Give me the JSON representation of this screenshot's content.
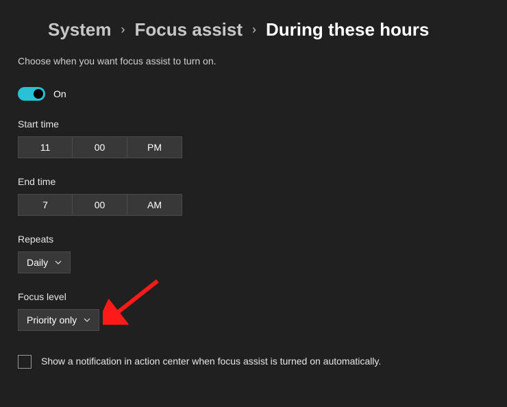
{
  "breadcrumb": {
    "item0": "System",
    "item1": "Focus assist",
    "current": "During these hours"
  },
  "description": "Choose when you want focus assist to turn on.",
  "toggle": {
    "state_label": "On"
  },
  "start_time": {
    "label": "Start time",
    "hour": "11",
    "minute": "00",
    "ampm": "PM"
  },
  "end_time": {
    "label": "End time",
    "hour": "7",
    "minute": "00",
    "ampm": "AM"
  },
  "repeats": {
    "label": "Repeats",
    "value": "Daily"
  },
  "focus_level": {
    "label": "Focus level",
    "value": "Priority only"
  },
  "checkbox": {
    "label": "Show a notification in action center when focus assist is turned on automatically."
  }
}
